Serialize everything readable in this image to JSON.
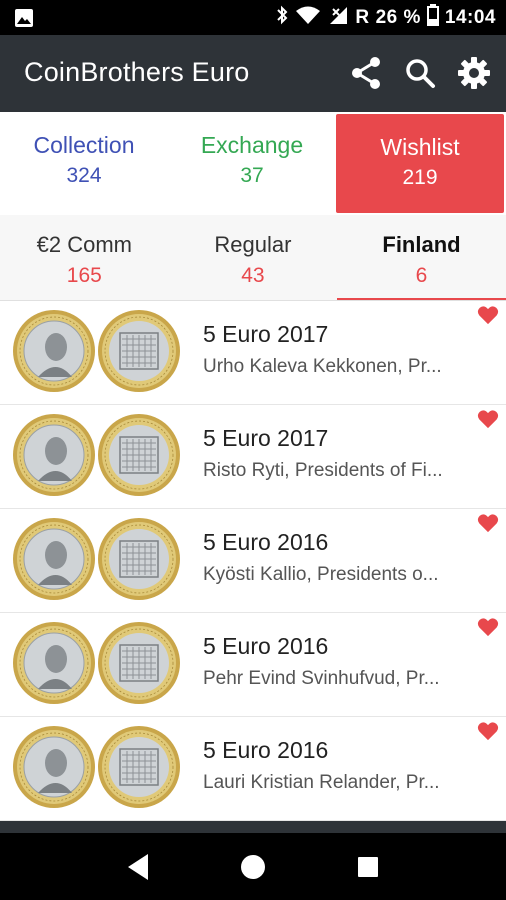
{
  "status": {
    "signal_icon": "signal-icon",
    "roaming": "R",
    "battery": "26 %",
    "time": "14:04"
  },
  "app": {
    "title": "CoinBrothers Euro"
  },
  "top_tabs": [
    {
      "label": "Collection",
      "count": "324"
    },
    {
      "label": "Exchange",
      "count": "37"
    },
    {
      "label": "Wishlist",
      "count": "219"
    }
  ],
  "sub_tabs": [
    {
      "label": "€2 Comm",
      "count": "165"
    },
    {
      "label": "Regular",
      "count": "43"
    },
    {
      "label": "Finland",
      "count": "6"
    }
  ],
  "coins": [
    {
      "title": "5 Euro 2017",
      "subtitle": "Urho Kaleva Kekkonen, Pr..."
    },
    {
      "title": "5 Euro 2017",
      "subtitle": "Risto Ryti, Presidents of Fi..."
    },
    {
      "title": "5 Euro 2016",
      "subtitle": "Kyösti Kallio, Presidents o..."
    },
    {
      "title": "5 Euro 2016",
      "subtitle": "Pehr Evind Svinhufvud, Pr..."
    },
    {
      "title": "5 Euro 2016",
      "subtitle": "Lauri Kristian Relander, Pr..."
    }
  ],
  "colors": {
    "app_bar": "#2e3338",
    "wishlist": "#e8484c",
    "collection": "#3f51b5",
    "exchange": "#34a853",
    "heart": "#e8484c"
  }
}
